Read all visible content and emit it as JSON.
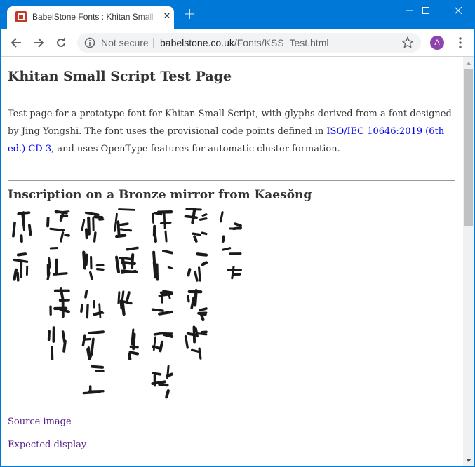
{
  "browser": {
    "tab_title": "BabelStone Fonts : Khitan Small Script Test Page",
    "new_tab_label": "+",
    "security_label": "Not secure",
    "url_domain": "babelstone.co.uk",
    "url_path": "/Fonts/KSS_Test.html",
    "profile_initial": "A",
    "profile_color": "#8e44ad",
    "accent_color": "#0078d7"
  },
  "page": {
    "title": "Khitan Small Script Test Page",
    "intro_before_link": "Test page for a prototype font for Khitan Small Script, with glyphs derived from a font designed by Jing Yongshi. The font uses the provisional code points defined in ",
    "intro_link": "ISO/IEC 10646:2019 (6th ed.) CD 3",
    "intro_after_link": ", and uses OpenType features for automatic cluster formation.",
    "section_title": "Inscription on a Bronze mirror from Kaesŏng",
    "inscription_columns": [
      {
        "glyph_count": 2
      },
      {
        "glyph_count": 4
      },
      {
        "glyph_count": 5
      },
      {
        "glyph_count": 4
      },
      {
        "glyph_count": 5
      },
      {
        "glyph_count": 4
      },
      {
        "glyph_count": 2
      }
    ],
    "source_link": "Source image",
    "expected_link": "Expected display"
  },
  "icons": {
    "back": "arrow-left-icon",
    "forward": "arrow-right-icon",
    "reload": "reload-icon",
    "info": "info-icon",
    "bookmark": "star-icon",
    "menu": "kebab-menu-icon",
    "minimize": "minimize-icon",
    "maximize": "maximize-icon",
    "close": "close-icon"
  }
}
